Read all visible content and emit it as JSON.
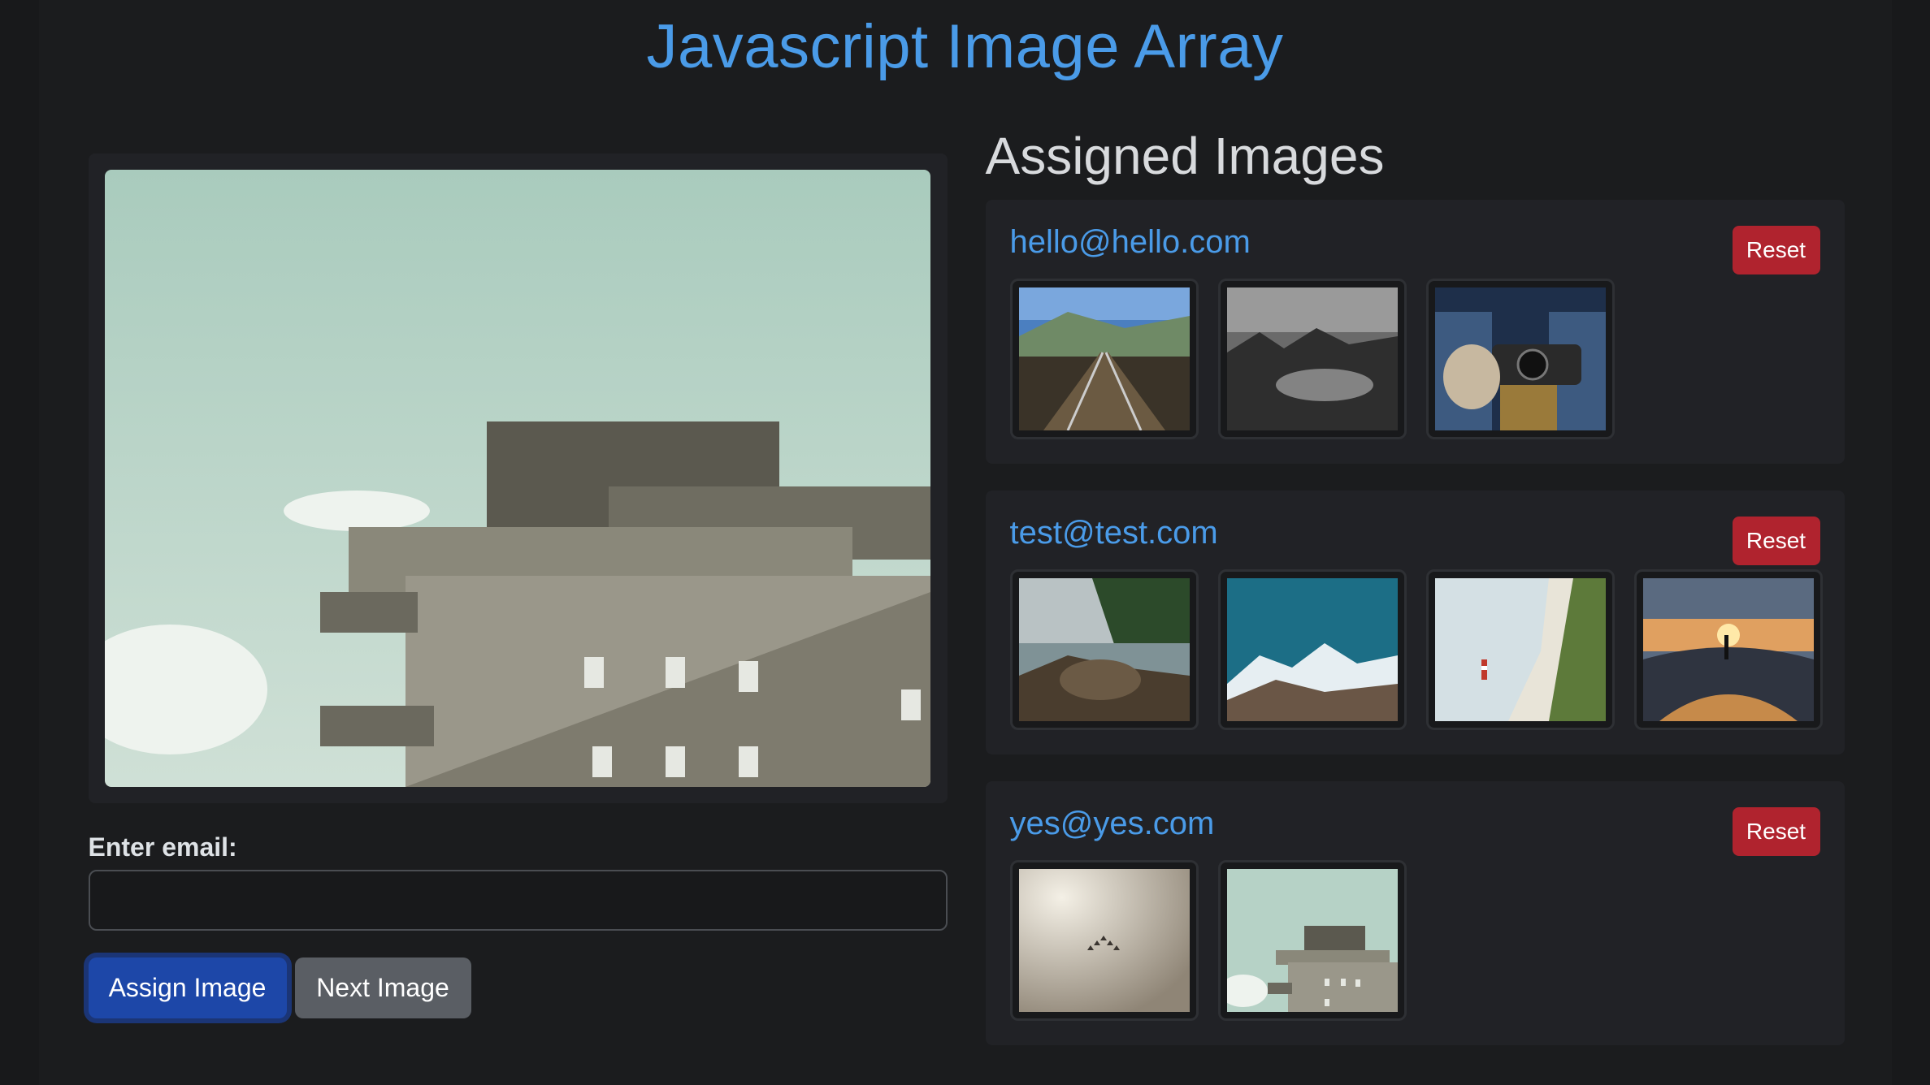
{
  "header": {
    "title": "Javascript Image Array"
  },
  "form": {
    "email_label": "Enter email:",
    "email_value": "",
    "assign_label": "Assign Image",
    "next_label": "Next Image"
  },
  "viewer": {
    "current_image": "concrete-bunker"
  },
  "assigned": {
    "title": "Assigned Images",
    "reset_label": "Reset",
    "groups": [
      {
        "email": "hello@hello.com",
        "images": [
          "railway-track",
          "rocky-coast-bw",
          "camera-hands"
        ]
      },
      {
        "email": "test@test.com",
        "images": [
          "river-rocks",
          "snowy-mountains",
          "cliff-lighthouse",
          "skatepark-sunset"
        ]
      },
      {
        "email": "yes@yes.com",
        "images": [
          "birds-hazy-sky",
          "concrete-bunker"
        ]
      }
    ]
  },
  "colors": {
    "accent": "#4a9be8",
    "primary": "#1d47a8",
    "secondary": "#5a5e64",
    "danger": "#b0232e"
  }
}
